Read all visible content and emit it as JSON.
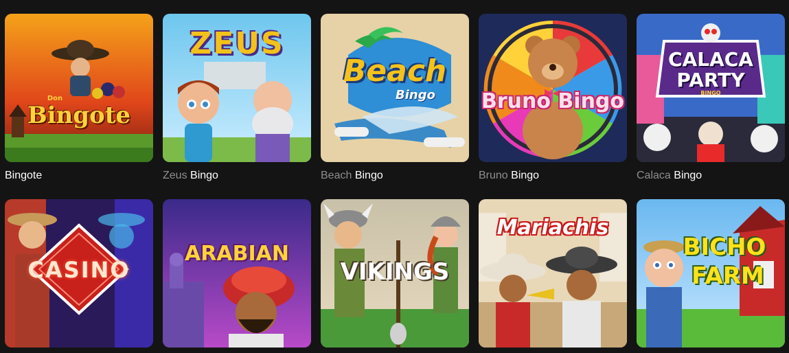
{
  "games": [
    {
      "logo": "Bingote",
      "logo_small": "Don",
      "title_dim": "",
      "title_bright": "Bingote",
      "title_tail": ""
    },
    {
      "logo": "ZEUS",
      "logo_small": "",
      "title_dim": "Zeus",
      "title_bright": "Bingo",
      "title_tail": ""
    },
    {
      "logo": "Beach",
      "logo_small": "Bingo",
      "title_dim": "Beach",
      "title_bright": "Bingo",
      "title_tail": ""
    },
    {
      "logo": "Bruno Bingo",
      "logo_small": "",
      "title_dim": "Bruno",
      "title_bright": "Bingo",
      "title_tail": ""
    },
    {
      "logo": "CALACA",
      "logo_small": "PARTY",
      "logo_tiny": "BINGO",
      "title_dim": "Calaca",
      "title_bright": "Bingo",
      "title_tail": ""
    },
    {
      "logo": "CASINO",
      "logo_small": ""
    },
    {
      "logo": "ARABIAN",
      "logo_small": ""
    },
    {
      "logo": "VIKINGS",
      "logo_small": ""
    },
    {
      "logo": "Mariachis",
      "logo_small": ""
    },
    {
      "logo": "BICHO",
      "logo_small": "FARM"
    }
  ],
  "colors": {
    "background": "#141414",
    "title_text": "#ffffff",
    "title_dim": "#8e8e8e"
  }
}
